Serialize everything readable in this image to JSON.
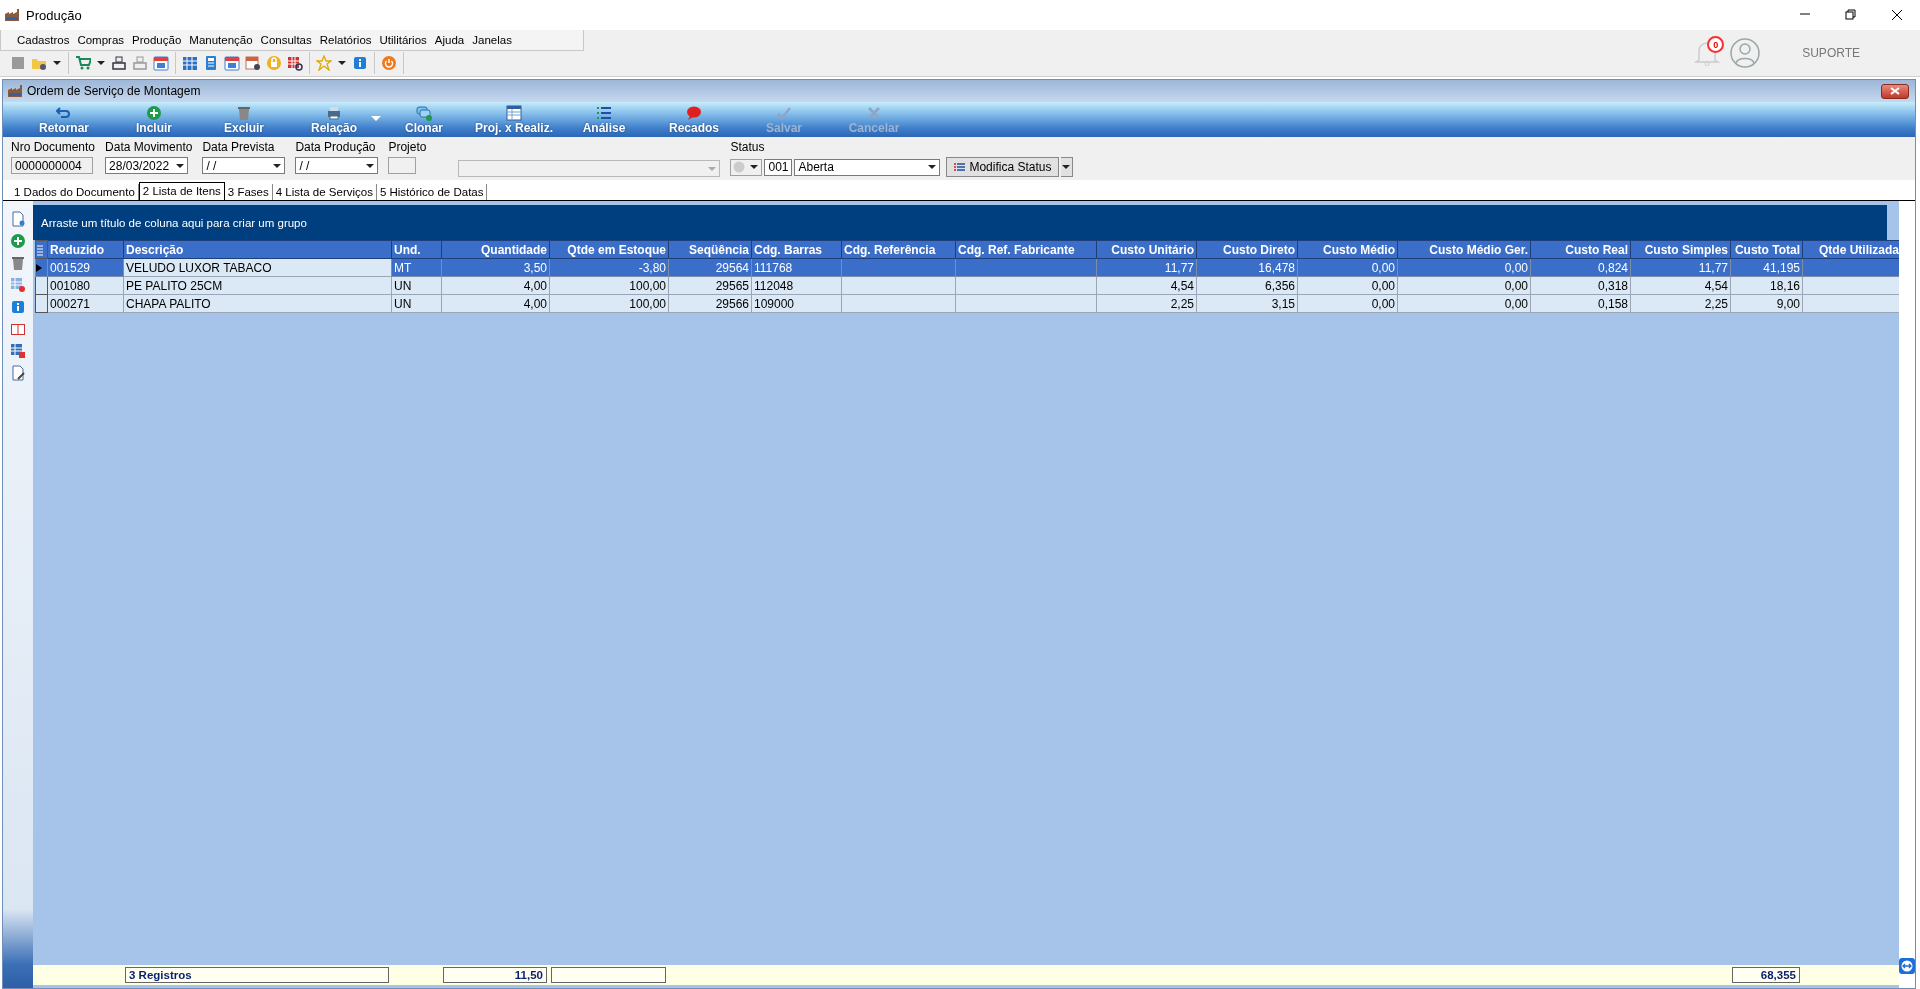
{
  "window": {
    "title": "Produção"
  },
  "menu": [
    "Cadastros",
    "Compras",
    "Produção",
    "Manutenção",
    "Consultas",
    "Relatórios",
    "Utilitários",
    "Ajuda",
    "Janelas"
  ],
  "notifications": {
    "count": "0"
  },
  "user": {
    "name": "SUPORTE"
  },
  "form": {
    "title": "Ordem de Serviço de Montagem",
    "toolbar": [
      {
        "label": "Retornar",
        "kind": "back",
        "disabled": false
      },
      {
        "label": "Incluir",
        "kind": "add",
        "disabled": false
      },
      {
        "label": "Excluir",
        "kind": "delete",
        "disabled": false
      },
      {
        "label": "Relação",
        "kind": "print",
        "disabled": false
      },
      {
        "label": "Clonar",
        "kind": "clone",
        "disabled": false
      },
      {
        "label": "Proj. x Realiz.",
        "kind": "table",
        "disabled": false
      },
      {
        "label": "Análise",
        "kind": "list",
        "disabled": false
      },
      {
        "label": "Recados",
        "kind": "message",
        "disabled": false
      },
      {
        "label": "Salvar",
        "kind": "save",
        "disabled": true
      },
      {
        "label": "Cancelar",
        "kind": "cancel",
        "disabled": true
      }
    ],
    "fields": [
      {
        "label": "Nro Documento",
        "value": "0000000004",
        "kind": "readonly"
      },
      {
        "label": "Data Movimento",
        "value": "28/03/2022",
        "kind": "date"
      },
      {
        "label": "Data Prevista",
        "value": "/ /",
        "kind": "date"
      },
      {
        "label": "Data Produção",
        "value": "/ /",
        "kind": "date"
      },
      {
        "label": "Projeto",
        "kind": "project"
      }
    ],
    "status": {
      "label": "Status",
      "code": "001",
      "value": "Aberta",
      "button": "Modifica Status"
    },
    "tabs": [
      {
        "label": "1 Dados do Documento",
        "selected": false
      },
      {
        "label": "2 Lista de Itens",
        "selected": true
      },
      {
        "label": "3 Fases",
        "selected": false
      },
      {
        "label": "4 Lista de Serviços",
        "selected": false
      },
      {
        "label": "5 Histórico de Datas",
        "selected": false
      }
    ],
    "grid": {
      "group_hint": "Arraste um título de coluna aqui para criar um grupo",
      "columns": [
        {
          "label": "Reduzido",
          "kind": "text",
          "footer_box": false
        },
        {
          "label": "Descrição",
          "kind": "text",
          "footer_box": true,
          "footer": "3 Registros"
        },
        {
          "label": "Und.",
          "kind": "text",
          "footer_box": false
        },
        {
          "label": "Quantidade",
          "kind": "number",
          "footer_box": true,
          "footer": "11,50"
        },
        {
          "label": "Qtde em Estoque",
          "kind": "number",
          "footer_box": true
        },
        {
          "label": "Seqüência",
          "kind": "number",
          "footer_box": false
        },
        {
          "label": "Cdg. Barras",
          "kind": "text",
          "footer_box": false
        },
        {
          "label": "Cdg. Referência",
          "kind": "text",
          "footer_box": false
        },
        {
          "label": "Cdg. Ref. Fabricante",
          "kind": "text",
          "footer_box": false
        },
        {
          "label": "Custo Unitário",
          "kind": "number",
          "footer_box": false
        },
        {
          "label": "Custo Direto",
          "kind": "number",
          "footer_box": false
        },
        {
          "label": "Custo Médio",
          "kind": "number",
          "footer_box": false
        },
        {
          "label": "Custo Médio Ger.",
          "kind": "number",
          "footer_box": false
        },
        {
          "label": "Custo Real",
          "kind": "number",
          "footer_box": false
        },
        {
          "label": "Custo Simples",
          "kind": "number",
          "footer_box": false
        },
        {
          "label": "Custo Total",
          "kind": "number",
          "footer_box": true,
          "footer": "68,355"
        },
        {
          "label": "Qtde Utilizada",
          "kind": "number",
          "footer_box": false
        }
      ],
      "rows": [
        {
          "selected": true,
          "cells": [
            "001529",
            "VELUDO LUXOR TABACO",
            "MT",
            "3,50",
            "-3,80",
            "29564",
            "111768",
            null,
            null,
            "11,77",
            "16,478",
            "0,00",
            "0,00",
            "0,824",
            "11,77",
            "41,195",
            null
          ]
        },
        {
          "selected": false,
          "cells": [
            "001080",
            "PE PALITO 25CM",
            "UN",
            "4,00",
            "100,00",
            "29565",
            "112048",
            null,
            null,
            "4,54",
            "6,356",
            "0,00",
            "0,00",
            "0,318",
            "4,54",
            "18,16",
            null
          ]
        },
        {
          "selected": false,
          "cells": [
            "000271",
            "CHAPA PALITO",
            "UN",
            "4,00",
            "100,00",
            "29566",
            "109000",
            null,
            null,
            "2,25",
            "3,15",
            "0,00",
            "0,00",
            "0,158",
            "2,25",
            "9,00",
            null
          ]
        }
      ]
    }
  }
}
